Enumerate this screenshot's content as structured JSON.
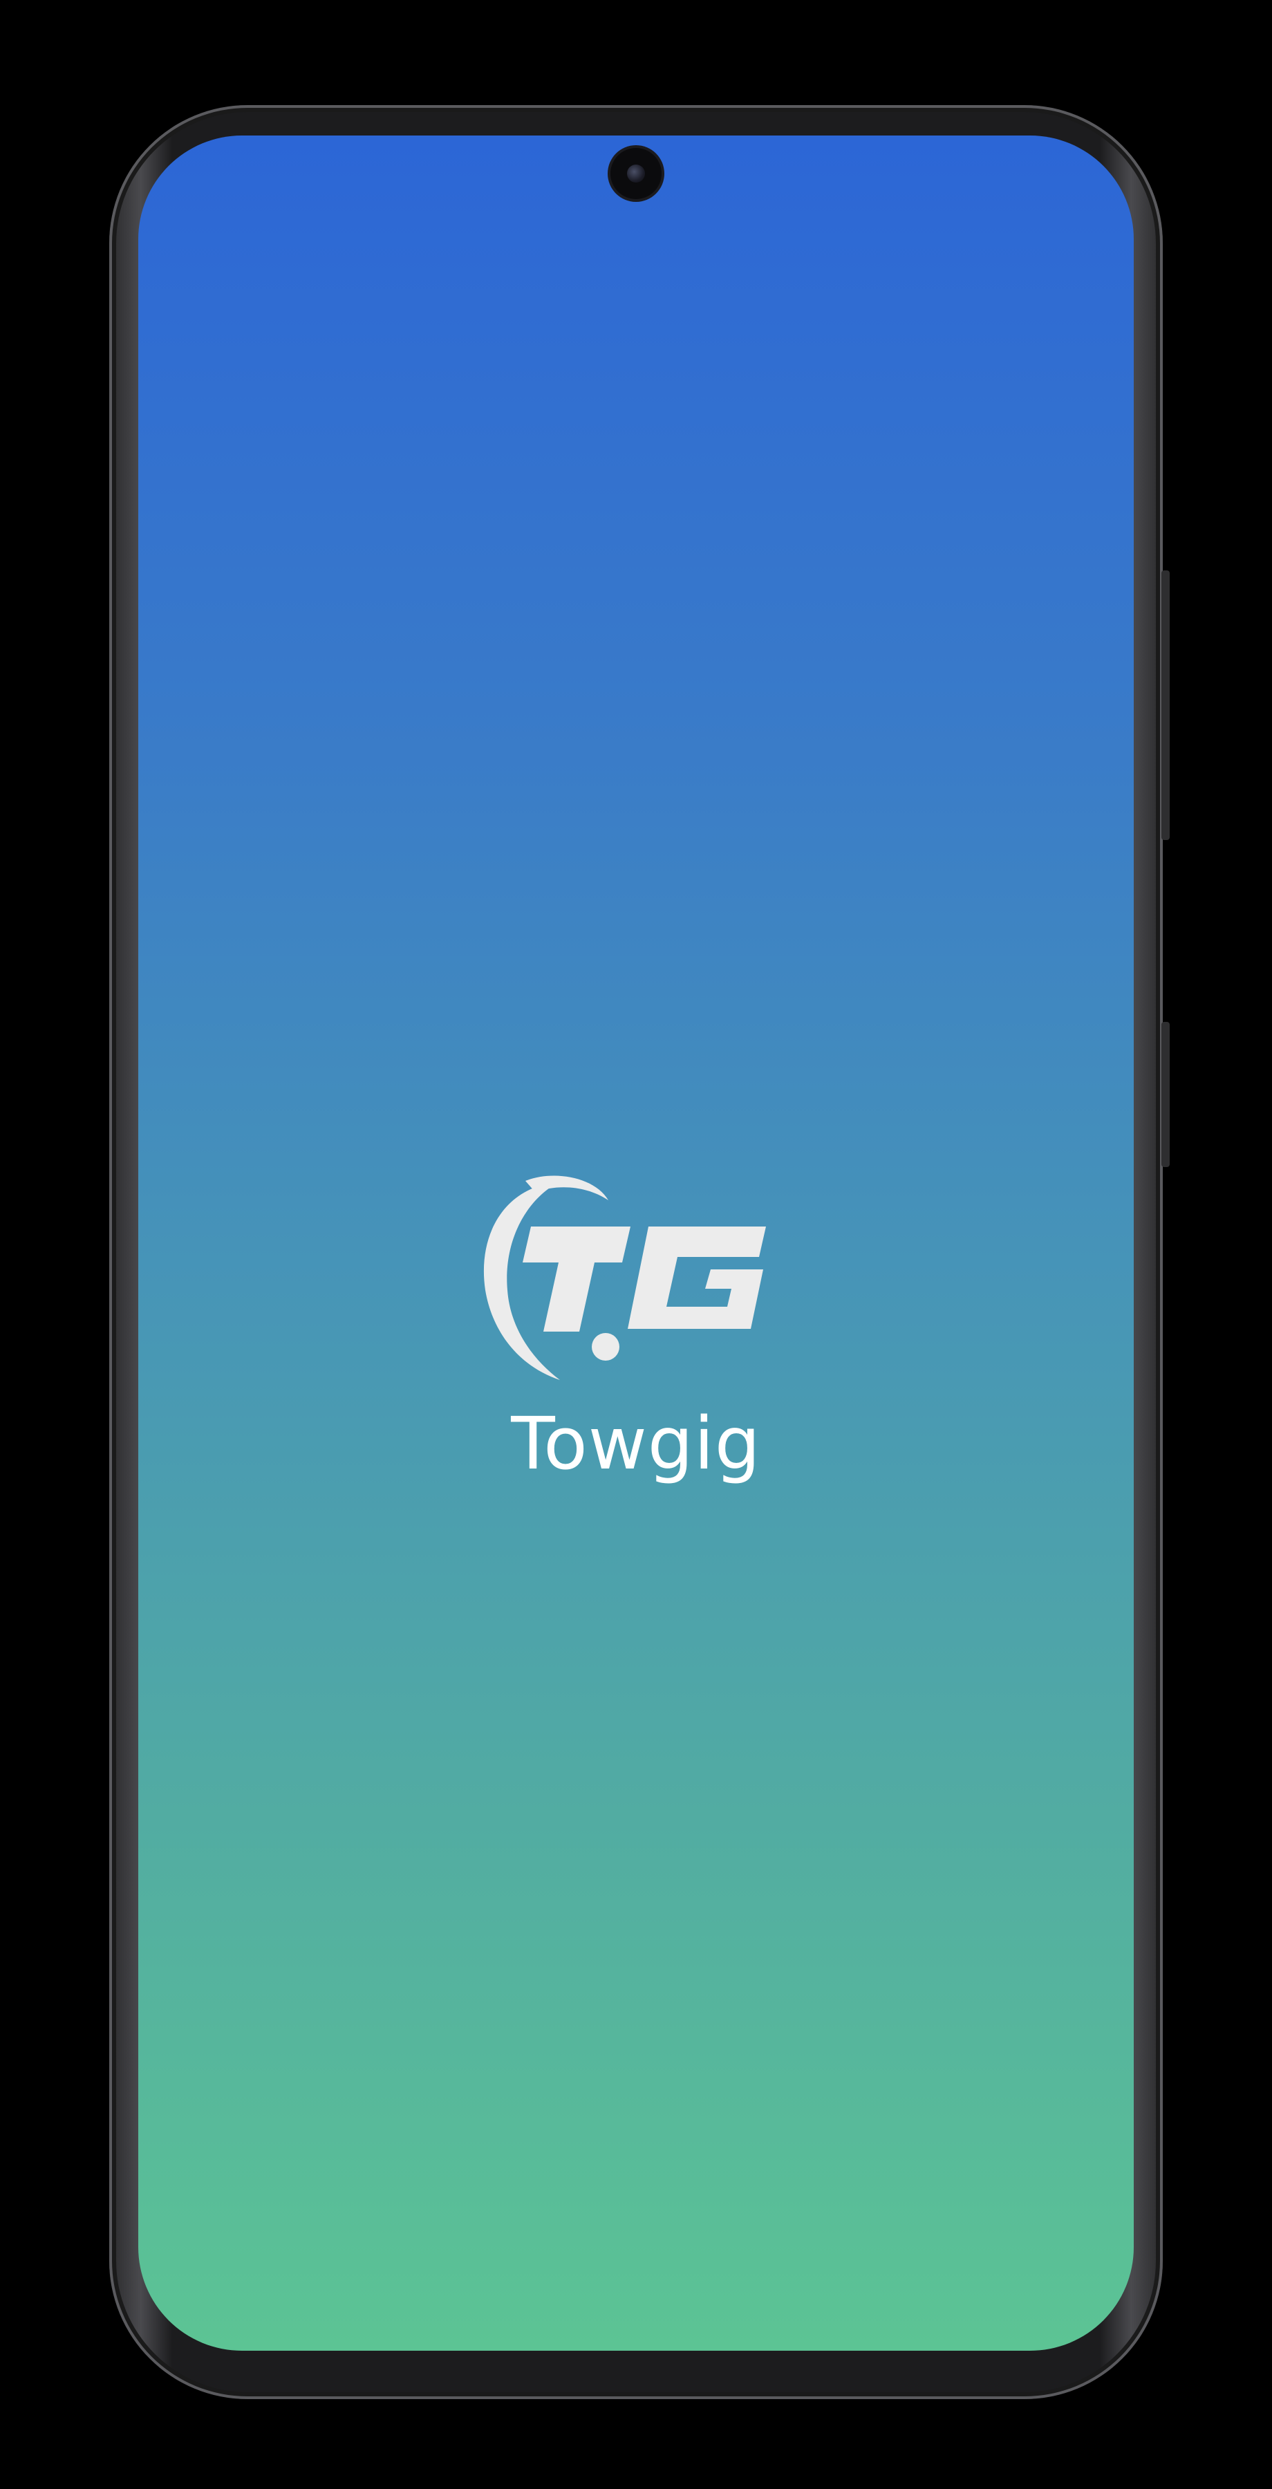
{
  "splash": {
    "app_name": "Towgig",
    "logo_text": "TG",
    "logo_icon": "towgig-logo-icon"
  },
  "device": {
    "camera_icon": "front-camera-icon"
  },
  "colors": {
    "gradient_top": "#2c66d6",
    "gradient_middle": "#4795b7",
    "gradient_bottom": "#5cc494",
    "logo_color": "#ececec",
    "text_color": "#ffffff"
  }
}
